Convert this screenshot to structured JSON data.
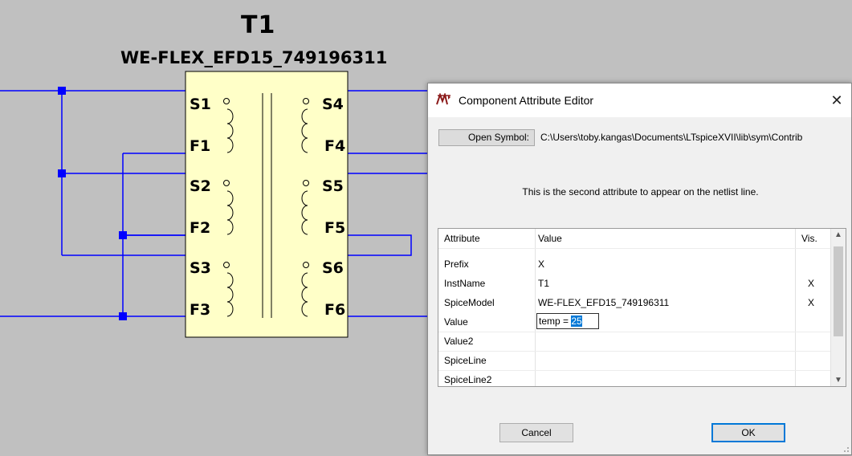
{
  "schematic": {
    "ref": "T1",
    "model": "WE-FLEX_EFD15_749196311",
    "pins": {
      "s1": "S1",
      "f1": "F1",
      "s2": "S2",
      "f2": "F2",
      "s3": "S3",
      "f3": "F3",
      "s4": "S4",
      "f4": "F4",
      "s5": "S5",
      "f5": "F5",
      "s6": "S6",
      "f6": "F6"
    },
    "colors": {
      "wire": "#0000ff",
      "body_fill": "#ffffc8",
      "background": "#c0c0c0"
    }
  },
  "dialog": {
    "title": "Component Attribute Editor",
    "close_symbol": "✕",
    "app_icon": "ltspice-icon",
    "open_symbol_label": "Open Symbol:",
    "symbol_path": "C:\\Users\\toby.kangas\\Documents\\LTspiceXVII\\lib\\sym\\Contrib",
    "hint": "This is the second attribute to appear on the netlist line.",
    "table": {
      "headers": {
        "attribute": "Attribute",
        "value": "Value",
        "vis": "Vis."
      },
      "rows": [
        {
          "attribute": "Prefix",
          "value": "X",
          "vis": ""
        },
        {
          "attribute": "InstName",
          "value": "T1",
          "vis": "X"
        },
        {
          "attribute": "SpiceModel",
          "value": "WE-FLEX_EFD15_749196311",
          "vis": "X"
        },
        {
          "attribute": "Value",
          "value": "",
          "vis": ""
        },
        {
          "attribute": "Value2",
          "value": "",
          "vis": ""
        },
        {
          "attribute": "SpiceLine",
          "value": "",
          "vis": ""
        },
        {
          "attribute": "SpiceLine2",
          "value": "",
          "vis": ""
        }
      ],
      "edit": {
        "prefix_text": "temp = ",
        "selected_text": "25"
      }
    },
    "cancel_label": "Cancel",
    "ok_label": "OK",
    "accent_color": "#0078d7"
  }
}
